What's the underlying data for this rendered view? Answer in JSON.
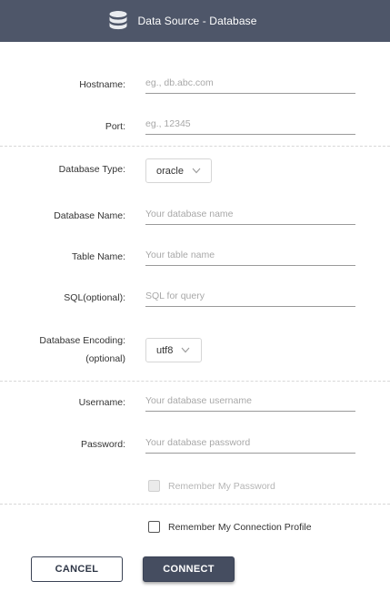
{
  "header": {
    "title": "Data Source - Database",
    "icon": "database-icon",
    "background": "#4e5669"
  },
  "form": {
    "hostname": {
      "label": "Hostname:",
      "placeholder": "eg., db.abc.com",
      "value": ""
    },
    "port": {
      "label": "Port:",
      "placeholder": "eg., 12345",
      "value": ""
    },
    "database_type": {
      "label": "Database Type:",
      "selected": "oracle"
    },
    "database_name": {
      "label": "Database Name:",
      "placeholder": "Your database name",
      "value": ""
    },
    "table_name": {
      "label": "Table Name:",
      "placeholder": "Your table name",
      "value": ""
    },
    "sql": {
      "label": "SQL(optional):",
      "placeholder": "SQL for query",
      "value": ""
    },
    "database_encoding": {
      "label_line1": "Database Encoding:",
      "label_line2": "(optional)",
      "selected": "utf8"
    },
    "username": {
      "label": "Username:",
      "placeholder": "Your database username",
      "value": ""
    },
    "password": {
      "label": "Password:",
      "placeholder": "Your database password",
      "value": ""
    },
    "remember_password": {
      "label": "Remember My Password",
      "checked": false,
      "disabled": true
    },
    "remember_profile": {
      "label": "Remember My Connection Profile",
      "checked": false
    }
  },
  "buttons": {
    "cancel": "CANCEL",
    "connect": "CONNECT",
    "connect_color": "#454d60"
  }
}
